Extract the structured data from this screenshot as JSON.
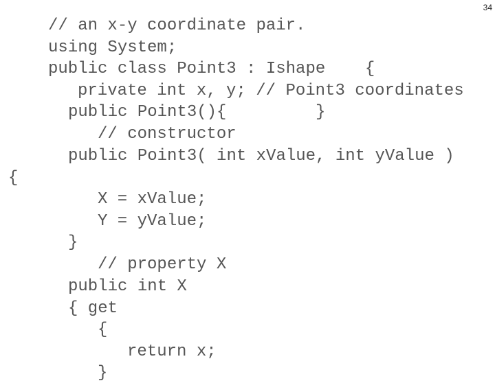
{
  "slide": {
    "page_number": "34"
  },
  "code": {
    "lines": [
      "// an x-y coordinate pair.",
      "using System;",
      "public class Point3 : Ishape    {",
      "private int x, y; // Point3 coordinates",
      "public Point3(){         }",
      "// constructor",
      "public Point3( int xValue, int yValue )",
      "{",
      "X = xValue;",
      "Y = yValue;",
      "}",
      "// property X",
      "public int X",
      "{ get",
      "{",
      "return x;",
      "}"
    ]
  }
}
